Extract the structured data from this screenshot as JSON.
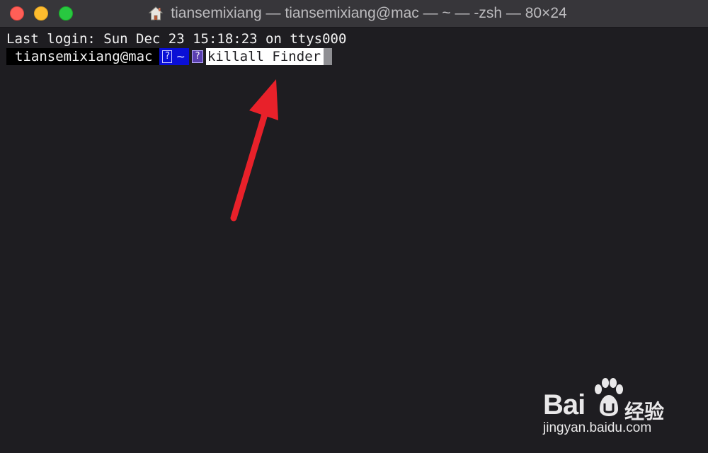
{
  "window": {
    "title": "tiansemixiang — tiansemixiang@mac — ~ — -zsh — 80×24",
    "controls": [
      "close",
      "minimize",
      "maximize"
    ],
    "title_icon": "home-icon"
  },
  "terminal": {
    "last_login": "Last login: Sun Dec 23 15:18:23 on ttys000",
    "prompt": {
      "user_host": "tiansemixiang@mac",
      "glyph_1": "?",
      "directory": "~",
      "glyph_2": "?"
    },
    "command": "killall Finder"
  },
  "annotation": {
    "icon": "red-arrow-icon",
    "color": "#e8212a"
  },
  "watermark": {
    "brand_latin": "Bai",
    "brand_cn": "经验",
    "url": "jingyan.baidu.com"
  },
  "colors": {
    "background": "#1e1d21",
    "titlebar": "#37363a",
    "prompt_dir_bg": "#0a0fd6",
    "command_bg": "#ffffff"
  }
}
